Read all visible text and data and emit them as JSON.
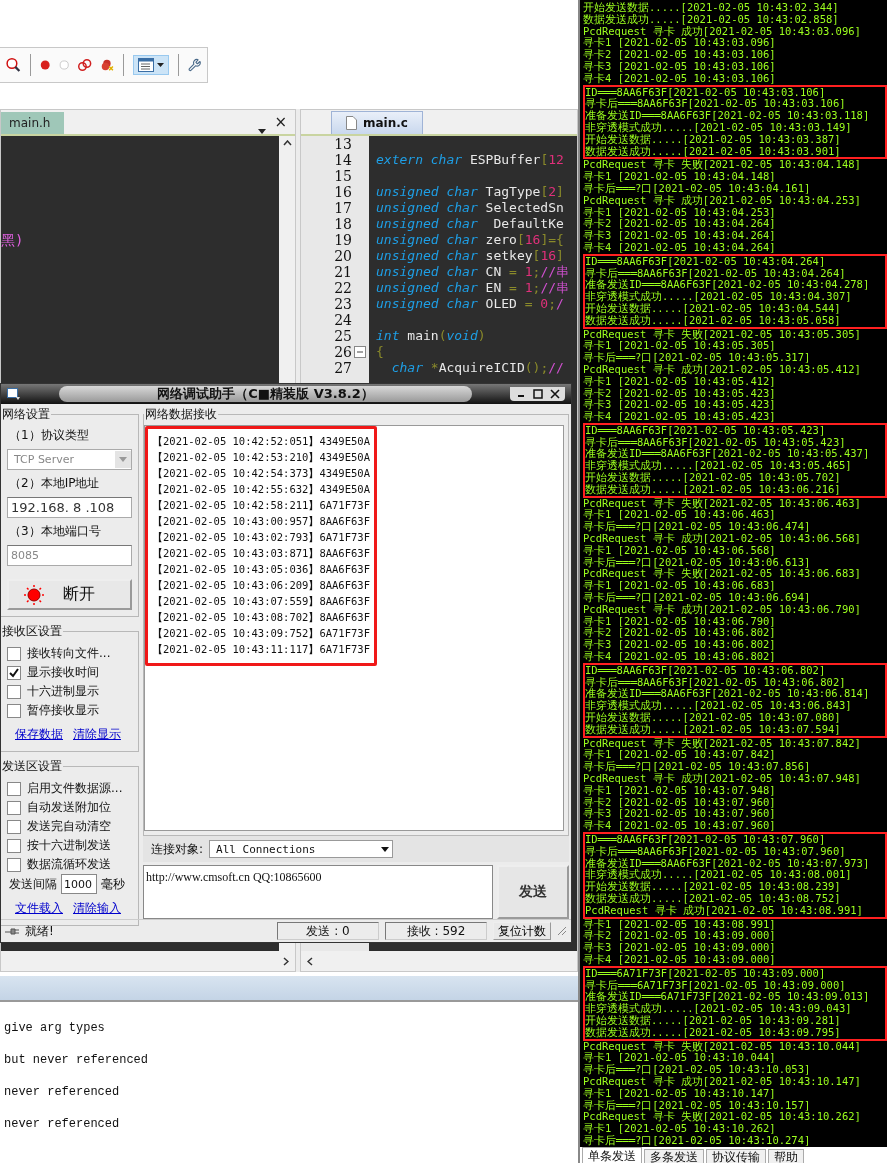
{
  "ide": {
    "left_tab": {
      "label": "main.h"
    },
    "left_tab_close": "×",
    "left_editor_text": "黑)",
    "right_tab": {
      "label": "main.c"
    },
    "code_lines": [
      {
        "number": "13"
      },
      {
        "number": "14",
        "segments": [
          {
            "kind": "keyword",
            "text": "extern char"
          },
          {
            "kind": "name",
            "text": " ESPBuffer"
          },
          {
            "kind": "punct",
            "text": "["
          },
          {
            "kind": "number",
            "text": "12"
          }
        ]
      },
      {
        "number": "15"
      },
      {
        "number": "16",
        "segments": [
          {
            "kind": "keyword",
            "text": "unsigned char"
          },
          {
            "kind": "name",
            "text": " TagType"
          },
          {
            "kind": "punct",
            "text": "["
          },
          {
            "kind": "number",
            "text": "2"
          },
          {
            "kind": "punct",
            "text": "]"
          }
        ]
      },
      {
        "number": "17",
        "segments": [
          {
            "kind": "keyword",
            "text": "unsigned char"
          },
          {
            "kind": "name",
            "text": " SelectedSn"
          }
        ]
      },
      {
        "number": "18",
        "segments": [
          {
            "kind": "keyword",
            "text": "unsigned char"
          },
          {
            "kind": "name",
            "text": "  DefaultKe"
          }
        ]
      },
      {
        "number": "19",
        "segments": [
          {
            "kind": "keyword",
            "text": "unsigned char"
          },
          {
            "kind": "name",
            "text": " zero"
          },
          {
            "kind": "punct",
            "text": "["
          },
          {
            "kind": "number",
            "text": "16"
          },
          {
            "kind": "punct",
            "text": "]={"
          }
        ]
      },
      {
        "number": "20",
        "segments": [
          {
            "kind": "keyword",
            "text": "unsigned char"
          },
          {
            "kind": "name",
            "text": " setkey"
          },
          {
            "kind": "punct",
            "text": "["
          },
          {
            "kind": "number",
            "text": "16"
          },
          {
            "kind": "punct",
            "text": "]"
          }
        ]
      },
      {
        "number": "21",
        "segments": [
          {
            "kind": "keyword",
            "text": "unsigned char"
          },
          {
            "kind": "name",
            "text": " CN "
          },
          {
            "kind": "punct",
            "text": "="
          },
          {
            "kind": "number",
            "text": " 1"
          },
          {
            "kind": "punct",
            "text": ";"
          },
          {
            "kind": "comment",
            "text": "//串"
          }
        ]
      },
      {
        "number": "22",
        "segments": [
          {
            "kind": "keyword",
            "text": "unsigned char"
          },
          {
            "kind": "name",
            "text": " EN "
          },
          {
            "kind": "punct",
            "text": "="
          },
          {
            "kind": "number",
            "text": " 1"
          },
          {
            "kind": "punct",
            "text": ";"
          },
          {
            "kind": "comment",
            "text": "//串"
          }
        ]
      },
      {
        "number": "23",
        "segments": [
          {
            "kind": "keyword",
            "text": "unsigned char"
          },
          {
            "kind": "name",
            "text": " OLED "
          },
          {
            "kind": "punct",
            "text": "="
          },
          {
            "kind": "number",
            "text": " 0"
          },
          {
            "kind": "punct",
            "text": ";"
          },
          {
            "kind": "comment",
            "text": "/"
          }
        ]
      },
      {
        "number": "24"
      },
      {
        "number": "25",
        "segments": [
          {
            "kind": "keyword",
            "text": "int"
          },
          {
            "kind": "name",
            "text": " main"
          },
          {
            "kind": "punct",
            "text": "("
          },
          {
            "kind": "keyword",
            "text": "void"
          },
          {
            "kind": "punct",
            "text": ")"
          }
        ]
      },
      {
        "number": "26",
        "fold": true,
        "segments": [
          {
            "kind": "punct",
            "text": "{"
          }
        ]
      },
      {
        "number": "27",
        "segments": [
          {
            "kind": "keyword",
            "text": "  char"
          },
          {
            "kind": "punct",
            "text": " *"
          },
          {
            "kind": "name",
            "text": "AcquireICID"
          },
          {
            "kind": "punct",
            "text": "()"
          },
          {
            "kind": "punct",
            "text": ";"
          },
          {
            "kind": "comment",
            "text": "//"
          }
        ]
      }
    ],
    "output_lines": [
      "give arg types",
      "but never referenced",
      "never referenced",
      "never referenced"
    ]
  },
  "dialog": {
    "title": "网络调试助手（C■精装版 V3.8.2）",
    "network_group": {
      "legend": "网络设置",
      "protocol_label": "（1）协议类型",
      "protocol": {
        "value": "TCP Server",
        "disabled": true
      },
      "ip_label": "（2）本地IP地址",
      "ip": "192.168. 8 .108",
      "port_label": "（3）本地端口号",
      "port": {
        "value": "8085",
        "disabled": true
      },
      "connect_button": "断开"
    },
    "receive_group": {
      "legend": "接收区设置",
      "options": [
        {
          "label": "接收转向文件...",
          "checked": false
        },
        {
          "label": "显示接收时间",
          "checked": true
        },
        {
          "label": "十六进制显示",
          "checked": false
        },
        {
          "label": "暂停接收显示",
          "checked": false
        }
      ],
      "links": [
        "保存数据",
        "清除显示"
      ]
    },
    "send_group": {
      "legend": "发送区设置",
      "options": [
        {
          "label": "启用文件数据源...",
          "checked": false
        },
        {
          "label": "自动发送附加位",
          "checked": false
        },
        {
          "label": "发送完自动清空",
          "checked": false
        },
        {
          "label": "按十六进制发送",
          "checked": false
        },
        {
          "label": "数据流循环发送",
          "checked": false
        }
      ],
      "interval_label": "发送间隔",
      "interval": "1000",
      "interval_unit": "毫秒",
      "links": [
        "文件载入",
        "清除输入"
      ]
    },
    "receive_area": {
      "legend": "网络数据接收",
      "lines": [
        "【2021-02-05 10:42:52:051】4349E50A",
        "【2021-02-05 10:42:53:210】4349E50A",
        "【2021-02-05 10:42:54:373】4349E50A",
        "【2021-02-05 10:42:55:632】4349E50A",
        "【2021-02-05 10:42:58:211】6A71F73F",
        "【2021-02-05 10:43:00:957】8AA6F63F",
        "【2021-02-05 10:43:02:793】6A71F73F",
        "【2021-02-05 10:43:03:871】8AA6F63F",
        "【2021-02-05 10:43:05:036】8AA6F63F",
        "【2021-02-05 10:43:06:209】8AA6F63F",
        "【2021-02-05 10:43:07:559】8AA6F63F",
        "【2021-02-05 10:43:08:702】8AA6F63F",
        "【2021-02-05 10:43:09:752】6A71F73F",
        "【2021-02-05 10:43:11:117】6A71F73F"
      ]
    },
    "target_label": "连接对象:",
    "target": "All Connections",
    "send_text": "http://www.cmsoft.cn QQ:10865600",
    "send_button": "发送",
    "status": {
      "text": "就绪!",
      "sent": "发送 : 0",
      "received": "接收 : 592",
      "reset_button": "复位计数"
    }
  },
  "terminal": {
    "blocks": [
      {
        "highlight": false,
        "lines": [
          "开始发送数据.....[2021-02-05 10:43:02.344]",
          "数据发送成功.....[2021-02-05 10:43:02.858]",
          "PcdRequest 寻卡 成功[2021-02-05 10:43:03.096]",
          "寻卡1 [2021-02-05 10:43:03.096]",
          "寻卡2 [2021-02-05 10:43:03.106]",
          "寻卡3 [2021-02-05 10:43:03.106]",
          "寻卡4 [2021-02-05 10:43:03.106]"
        ]
      },
      {
        "highlight": true,
        "lines": [
          "ID═══8AA6F63F[2021-02-05 10:43:03.106]",
          "寻卡后═══8AA6F63F[2021-02-05 10:43:03.106]",
          "准备发送ID═══8AA6F63F[2021-02-05 10:43:03.118]",
          "非穿透模式成功.....[2021-02-05 10:43:03.149]",
          "开始发送数据.....[2021-02-05 10:43:03.387]",
          "数据发送成功.....[2021-02-05 10:43:03.901]"
        ]
      },
      {
        "highlight": false,
        "lines": [
          "PcdRequest 寻卡 失败[2021-02-05 10:43:04.148]",
          "寻卡1 [2021-02-05 10:43:04.148]",
          "寻卡后═══?口[2021-02-05 10:43:04.161]",
          "PcdRequest 寻卡 成功[2021-02-05 10:43:04.253]",
          "寻卡1 [2021-02-05 10:43:04.253]",
          "寻卡2 [2021-02-05 10:43:04.264]",
          "寻卡3 [2021-02-05 10:43:04.264]",
          "寻卡4 [2021-02-05 10:43:04.264]"
        ]
      },
      {
        "highlight": true,
        "lines": [
          "ID═══8AA6F63F[2021-02-05 10:43:04.264]",
          "寻卡后═══8AA6F63F[2021-02-05 10:43:04.264]",
          "准备发送ID═══8AA6F63F[2021-02-05 10:43:04.278]",
          "非穿透模式成功.....[2021-02-05 10:43:04.307]",
          "开始发送数据.....[2021-02-05 10:43:04.544]",
          "数据发送成功.....[2021-02-05 10:43:05.058]"
        ]
      },
      {
        "highlight": false,
        "lines": [
          "PcdRequest 寻卡 失败[2021-02-05 10:43:05.305]",
          "寻卡1 [2021-02-05 10:43:05.305]",
          "寻卡后═══?口[2021-02-05 10:43:05.317]",
          "PcdRequest 寻卡 成功[2021-02-05 10:43:05.412]",
          "寻卡1 [2021-02-05 10:43:05.412]",
          "寻卡2 [2021-02-05 10:43:05.423]",
          "寻卡3 [2021-02-05 10:43:05.423]",
          "寻卡4 [2021-02-05 10:43:05.423]"
        ]
      },
      {
        "highlight": true,
        "lines": [
          "ID═══8AA6F63F[2021-02-05 10:43:05.423]",
          "寻卡后═══8AA6F63F[2021-02-05 10:43:05.423]",
          "准备发送ID═══8AA6F63F[2021-02-05 10:43:05.437]",
          "非穿透模式成功.....[2021-02-05 10:43:05.465]",
          "开始发送数据.....[2021-02-05 10:43:05.702]",
          "数据发送成功.....[2021-02-05 10:43:06.216]"
        ]
      },
      {
        "highlight": false,
        "lines": [
          "PcdRequest 寻卡 失败[2021-02-05 10:43:06.463]",
          "寻卡1 [2021-02-05 10:43:06.463]",
          "寻卡后═══?口[2021-02-05 10:43:06.474]",
          "PcdRequest 寻卡 成功[2021-02-05 10:43:06.568]",
          "寻卡1 [2021-02-05 10:43:06.568]",
          "寻卡后═══?口[2021-02-05 10:43:06.613]",
          "PcdRequest 寻卡 失败[2021-02-05 10:43:06.683]",
          "寻卡1 [2021-02-05 10:43:06.683]",
          "寻卡后═══?口[2021-02-05 10:43:06.694]",
          "PcdRequest 寻卡 成功[2021-02-05 10:43:06.790]",
          "寻卡1 [2021-02-05 10:43:06.790]",
          "寻卡2 [2021-02-05 10:43:06.802]",
          "寻卡3 [2021-02-05 10:43:06.802]",
          "寻卡4 [2021-02-05 10:43:06.802]"
        ]
      },
      {
        "highlight": true,
        "lines": [
          "ID═══8AA6F63F[2021-02-05 10:43:06.802]",
          "寻卡后═══8AA6F63F[2021-02-05 10:43:06.802]",
          "准备发送ID═══8AA6F63F[2021-02-05 10:43:06.814]",
          "非穿透模式成功.....[2021-02-05 10:43:06.843]",
          "开始发送数据.....[2021-02-05 10:43:07.080]",
          "数据发送成功.....[2021-02-05 10:43:07.594]"
        ]
      },
      {
        "highlight": false,
        "lines": [
          "PcdRequest 寻卡 失败[2021-02-05 10:43:07.842]",
          "寻卡1 [2021-02-05 10:43:07.842]",
          "寻卡后═══?口[2021-02-05 10:43:07.856]",
          "PcdRequest 寻卡 成功[2021-02-05 10:43:07.948]",
          "寻卡1 [2021-02-05 10:43:07.948]",
          "寻卡2 [2021-02-05 10:43:07.960]",
          "寻卡3 [2021-02-05 10:43:07.960]",
          "寻卡4 [2021-02-05 10:43:07.960]"
        ]
      },
      {
        "highlight": true,
        "lines": [
          "ID═══8AA6F63F[2021-02-05 10:43:07.960]",
          "寻卡后═══8AA6F63F[2021-02-05 10:43:07.960]",
          "准备发送ID═══8AA6F63F[2021-02-05 10:43:07.973]",
          "非穿透模式成功.....[2021-02-05 10:43:08.001]",
          "开始发送数据.....[2021-02-05 10:43:08.239]",
          "数据发送成功.....[2021-02-05 10:43:08.752]",
          "PcdRequest 寻卡 成功[2021-02-05 10:43:08.991]"
        ]
      },
      {
        "highlight": false,
        "lines": [
          "寻卡1 [2021-02-05 10:43:08.991]",
          "寻卡2 [2021-02-05 10:43:09.000]",
          "寻卡3 [2021-02-05 10:43:09.000]",
          "寻卡4 [2021-02-05 10:43:09.000]"
        ]
      },
      {
        "highlight": true,
        "lines": [
          "ID═══6A71F73F[2021-02-05 10:43:09.000]",
          "寻卡后═══6A71F73F[2021-02-05 10:43:09.000]",
          "准备发送ID═══6A71F73F[2021-02-05 10:43:09.013]",
          "非穿透模式成功.....[2021-02-05 10:43:09.043]",
          "开始发送数据.....[2021-02-05 10:43:09.281]",
          "数据发送成功.....[2021-02-05 10:43:09.795]"
        ]
      },
      {
        "highlight": false,
        "lines": [
          "PcdRequest 寻卡 失败[2021-02-05 10:43:10.044]",
          "寻卡1 [2021-02-05 10:43:10.044]",
          "寻卡后═══?口[2021-02-05 10:43:10.053]",
          "PcdRequest 寻卡 成功[2021-02-05 10:43:10.147]",
          "寻卡1 [2021-02-05 10:43:10.147]",
          "寻卡后═══?口[2021-02-05 10:43:10.157]",
          "PcdRequest 寻卡 失败[2021-02-05 10:43:10.262]",
          "寻卡1 [2021-02-05 10:43:10.262]",
          "寻卡后═══?口[2021-02-05 10:43:10.274]"
        ]
      }
    ],
    "tabs": [
      {
        "label": "单条发送",
        "selected": true
      },
      {
        "label": "多条发送",
        "selected": false
      },
      {
        "label": "协议传输",
        "selected": false
      },
      {
        "label": "帮助",
        "selected": false
      }
    ]
  }
}
